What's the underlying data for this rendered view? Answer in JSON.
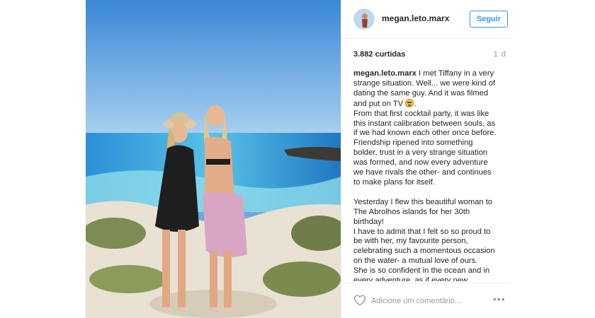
{
  "post": {
    "username": "megan.leto.marx",
    "follow_label": "Seguir",
    "likes": "3.882 curtidas",
    "age": "1 d",
    "caption_user": "megan.leto.marx",
    "caption_text_1": " I met Tiffany in a very strange situation. Well... we were kind of dating the same guy. And it was filmed and put on TV ",
    "caption_emoji": "grimacing-face-emoji",
    "caption_text_2": ".\nFrom that first cocktail party, it was like this instant calibration between souls, as if we had known each other once before. Friendship ripened into something bolder, trust in a very strange situation was formed, and now every adventure we have rivals the other- and continues to make plans for itself.\n\nYesterday I flew this beautiful woman to The Abrolhos islands for her 30th birthday!\nI have to admit that I felt so so proud to be with her, my favourite person, celebrating such a momentous occasion on the water- a mutual love of ours.\nShe is so confident in the ocean and in every adventure, as if every new experience is a mission of the latter",
    "comment_placeholder": "Adicione um comentário...",
    "more_label": "•••"
  },
  "icons": {
    "like": "heart-icon",
    "more": "more-options-icon"
  },
  "colors": {
    "accent": "#3897f0",
    "border": "#efefef",
    "muted": "#999999",
    "text": "#262626"
  }
}
